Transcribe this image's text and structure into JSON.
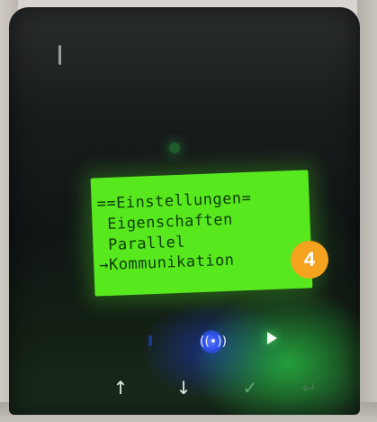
{
  "display": {
    "lines": [
      "==Einstellungen=",
      " Eigenschaften",
      " Parallel",
      "→Kommunikation"
    ]
  },
  "annotation": {
    "badge": "4"
  },
  "indicators": [
    {
      "icon": "status-led-icon",
      "color": "#1c3a8a"
    },
    {
      "icon": "wireless-icon",
      "glyph": "((•))",
      "color": "#2d4fea"
    },
    {
      "icon": "play-icon",
      "color": "#4fff6a"
    }
  ],
  "keys": [
    {
      "icon": "arrow-up-icon",
      "glyph": "↑"
    },
    {
      "icon": "arrow-down-icon",
      "glyph": "↓"
    },
    {
      "icon": "checkmark-icon",
      "glyph": "✓"
    },
    {
      "icon": "return-icon",
      "glyph": "↵"
    }
  ],
  "colors": {
    "lcd_background": "#58e81e",
    "lcd_text": "#0f3d08",
    "badge": "#f5a31f"
  }
}
